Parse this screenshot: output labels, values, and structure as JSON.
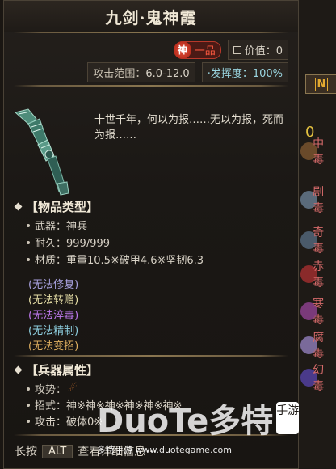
{
  "item": {
    "name": "九剑·鬼神霞",
    "rank_circle": "神",
    "rank_label": "一品",
    "value_label": "价值：0",
    "attack_range_label": "攻击范围：",
    "attack_range_value": "6.0-12.0",
    "mastery_label": "·发挥度：",
    "mastery_value": "100%",
    "description": "十世千年，何以为报……无以为报，死而为报……"
  },
  "item_type": {
    "heading": "【物品类型】",
    "weapon": "武器：神兵",
    "durability": "耐久：999/999",
    "material": "材质：重量10.5※破甲4.6※坚韧6.3"
  },
  "restrictions": [
    {
      "text": "(无法修复)",
      "color": "#a9a2e0"
    },
    {
      "text": "(无法转赠)",
      "color": "#e8e0a8"
    },
    {
      "text": "(无法淬毒)",
      "color": "#c07af0"
    },
    {
      "text": "(无法精制)",
      "color": "#8fcfe0"
    },
    {
      "text": "(无法变招)",
      "color": "#e0b060"
    }
  ],
  "weapon_attrs": {
    "heading": "【兵器属性】",
    "stance_label": "攻势：",
    "moves_label": "招式：神※神※神※神※神※神※",
    "attack_label": "攻击：破体0※"
  },
  "footer": {
    "prefix": "长按",
    "key": "ALT",
    "suffix": "查看详细信息···"
  },
  "side_strip": {
    "button_label": "N",
    "items": [
      {
        "text": "0",
        "color": "#e2c040"
      },
      {
        "text": "中毒",
        "color": "#d56a6a"
      },
      {
        "text": "剧毒",
        "color": "#d56a6a"
      },
      {
        "text": "奇毒",
        "color": "#d56a6a"
      },
      {
        "text": "赤毒",
        "color": "#d56a6a"
      },
      {
        "text": "寒毒",
        "color": "#d56a6a"
      },
      {
        "text": "腐毒",
        "color": "#d56a6a"
      },
      {
        "text": "幻毒",
        "color": "#d56a6a"
      }
    ]
  },
  "watermark": {
    "logo": "DuoTe多特",
    "badge": "手游",
    "subtitle": "多特手游 www.duotegame.com"
  }
}
